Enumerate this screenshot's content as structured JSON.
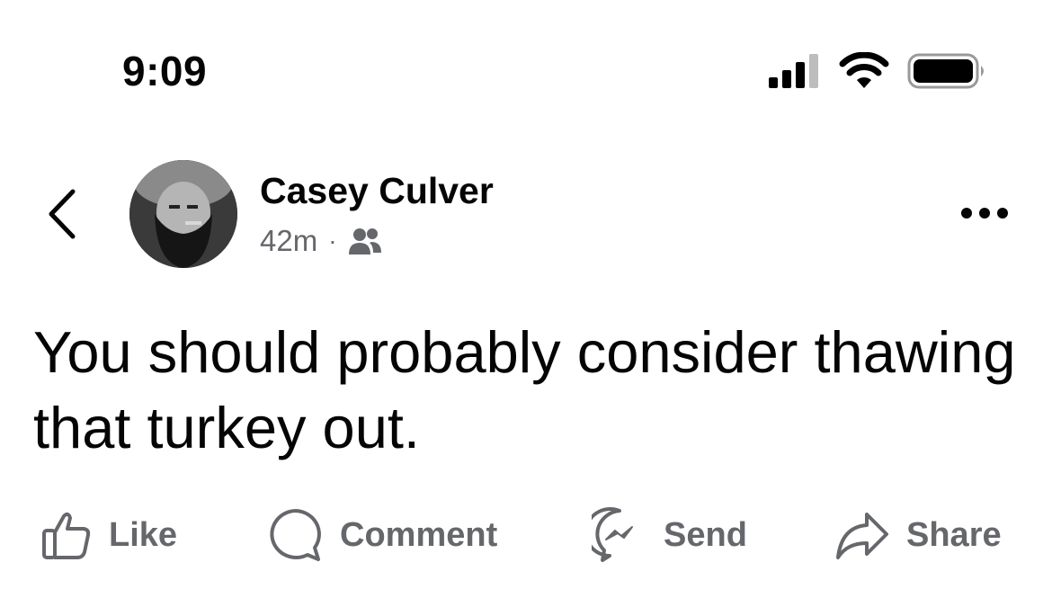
{
  "status_bar": {
    "time": "9:09",
    "icons": [
      "cellular-signal-icon",
      "wifi-icon",
      "battery-icon"
    ]
  },
  "post": {
    "author": "Casey Culver",
    "timestamp": "42m",
    "separator": "·",
    "audience_icon": "friends-icon",
    "text": "You should probably consider thawing that turkey out."
  },
  "actions": {
    "like": "Like",
    "comment": "Comment",
    "send": "Send",
    "share": "Share"
  },
  "colors": {
    "text_primary": "#050505",
    "text_secondary": "#65676b"
  }
}
